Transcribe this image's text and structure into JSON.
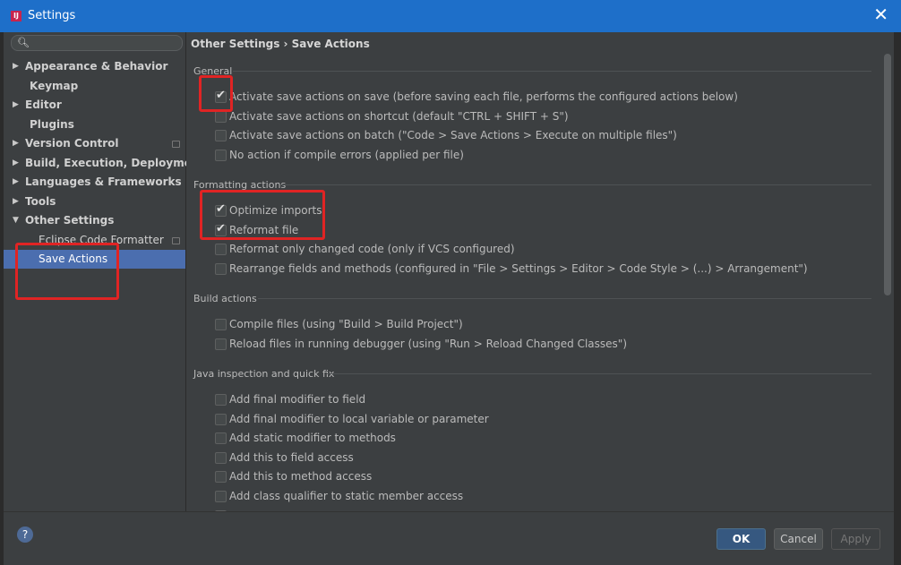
{
  "window": {
    "title": "Settings",
    "close_glyph": "✕",
    "icon": "intellij-icon"
  },
  "search": {
    "placeholder": ""
  },
  "sidebar": {
    "items": [
      {
        "label": "Appearance & Behavior",
        "arrow": "▶"
      },
      {
        "label": "Keymap",
        "arrow": ""
      },
      {
        "label": "Editor",
        "arrow": "▶"
      },
      {
        "label": "Plugins",
        "arrow": ""
      },
      {
        "label": "Version Control",
        "arrow": "▶"
      },
      {
        "label": "Build, Execution, Deployment",
        "arrow": "▶"
      },
      {
        "label": "Languages & Frameworks",
        "arrow": "▶"
      },
      {
        "label": "Tools",
        "arrow": "▶"
      },
      {
        "label": "Other Settings",
        "arrow": "▼"
      },
      {
        "label": "Eclipse Code Formatter",
        "arrow": ""
      },
      {
        "label": "Save Actions",
        "arrow": ""
      }
    ]
  },
  "breadcrumb": "Other Settings › Save Actions",
  "sections": {
    "general": {
      "title": "General",
      "options": [
        {
          "label": "Activate save actions on save (before saving each file, performs the configured actions below)",
          "checked": true
        },
        {
          "label": "Activate save actions on shortcut (default \"CTRL + SHIFT + S\")",
          "checked": false
        },
        {
          "label": "Activate save actions on batch (\"Code > Save Actions > Execute on multiple files\")",
          "checked": false
        },
        {
          "label": "No action if compile errors (applied per file)",
          "checked": false
        }
      ]
    },
    "formatting": {
      "title": "Formatting actions",
      "options": [
        {
          "label": "Optimize imports",
          "checked": true
        },
        {
          "label": "Reformat file",
          "checked": true
        },
        {
          "label": "Reformat only changed code (only if VCS configured)",
          "checked": false
        },
        {
          "label": "Rearrange fields and methods (configured in \"File > Settings > Editor > Code Style > (...) > Arrangement\")",
          "checked": false
        }
      ]
    },
    "build": {
      "title": "Build actions",
      "options": [
        {
          "label": "Compile files (using \"Build > Build Project\")",
          "checked": false
        },
        {
          "label": "Reload files in running debugger (using \"Run > Reload Changed Classes\")",
          "checked": false
        }
      ]
    },
    "java": {
      "title": "Java inspection and quick fix",
      "options": [
        {
          "label": "Add final modifier to field",
          "checked": false
        },
        {
          "label": "Add final modifier to local variable or parameter",
          "checked": false
        },
        {
          "label": "Add static modifier to methods",
          "checked": false
        },
        {
          "label": "Add this to field access",
          "checked": false
        },
        {
          "label": "Add this to method access",
          "checked": false
        },
        {
          "label": "Add class qualifier to static member access",
          "checked": false
        }
      ]
    }
  },
  "footer": {
    "help": "?",
    "ok": "OK",
    "cancel": "Cancel",
    "apply": "Apply"
  },
  "colors": {
    "accent": "#1e6fc9",
    "selection": "#4b6eaf",
    "highlight": "#e02424"
  }
}
